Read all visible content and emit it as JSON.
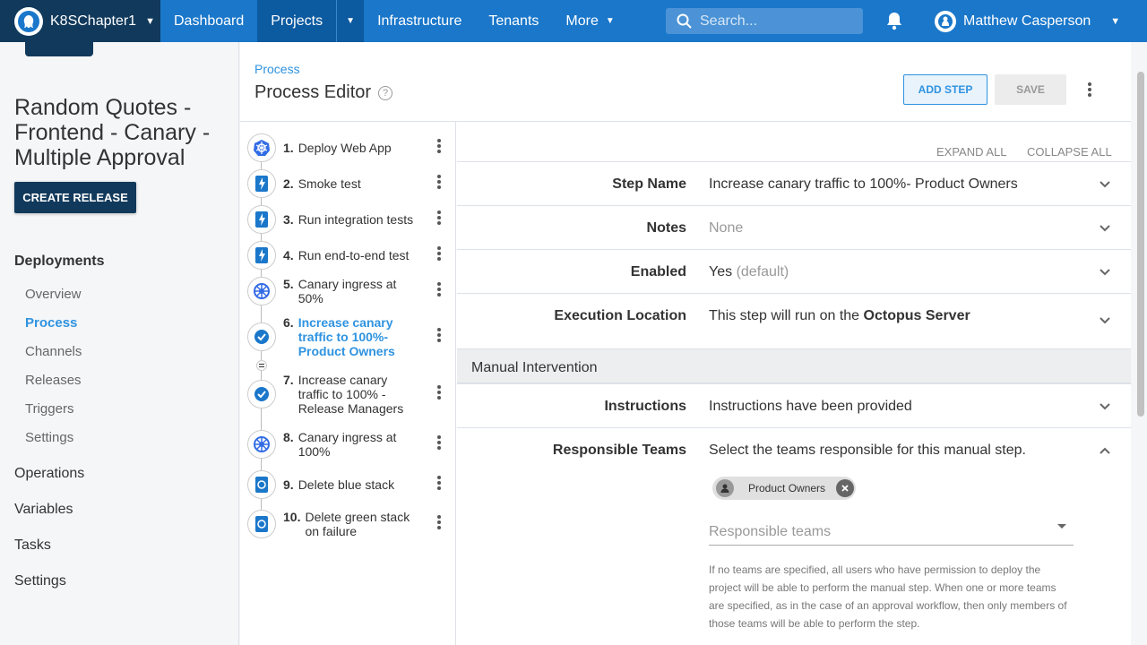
{
  "topnav": {
    "space": "K8SChapter1",
    "items": [
      "Dashboard",
      "Projects",
      "Infrastructure",
      "Tenants",
      "More"
    ],
    "search_placeholder": "Search...",
    "user": "Matthew Casperson"
  },
  "sidebar": {
    "project_title": "Random Quotes - Frontend - Canary - Multiple Approval",
    "create_release": "CREATE RELEASE",
    "deployments_heading": "Deployments",
    "deployments_items": [
      "Overview",
      "Process",
      "Channels",
      "Releases",
      "Triggers",
      "Settings"
    ],
    "active_item": "Process",
    "sections": [
      "Operations",
      "Variables",
      "Tasks",
      "Settings"
    ]
  },
  "main": {
    "breadcrumb": "Process",
    "title": "Process Editor",
    "add_step": "ADD STEP",
    "save": "SAVE",
    "expand_all": "EXPAND ALL",
    "collapse_all": "COLLAPSE ALL"
  },
  "steps": [
    {
      "num": "1.",
      "label": "Deploy Web App",
      "icon": "kubernetes-icon"
    },
    {
      "num": "2.",
      "label": "Smoke test",
      "icon": "script-icon"
    },
    {
      "num": "3.",
      "label": "Run integration tests",
      "icon": "script-icon"
    },
    {
      "num": "4.",
      "label": "Run end-to-end test",
      "icon": "script-icon"
    },
    {
      "num": "5.",
      "label": "Canary ingress at 50%",
      "icon": "kubernetes-icon"
    },
    {
      "num": "6.",
      "label": "Increase canary traffic to 100%- Product Owners",
      "icon": "check-icon",
      "selected": true
    },
    {
      "num": "7.",
      "label": "Increase canary traffic to 100% - Release Managers",
      "icon": "check-icon"
    },
    {
      "num": "8.",
      "label": "Canary ingress at 100%",
      "icon": "kubernetes-icon"
    },
    {
      "num": "9.",
      "label": "Delete blue stack",
      "icon": "kubernetes-script-icon"
    },
    {
      "num": "10.",
      "label": "Delete green stack on failure",
      "icon": "kubernetes-script-icon"
    }
  ],
  "details": {
    "step_name_label": "Step Name",
    "step_name_value": "Increase canary traffic to 100%- Product Owners",
    "notes_label": "Notes",
    "notes_value": "None",
    "enabled_label": "Enabled",
    "enabled_value": "Yes",
    "enabled_default": "(default)",
    "exec_label": "Execution Location",
    "exec_value_prefix": "This step will run on the",
    "exec_value_bold": "Octopus Server",
    "section_title": "Manual Intervention",
    "instructions_label": "Instructions",
    "instructions_value": "Instructions have been provided",
    "teams_label": "Responsible Teams",
    "teams_value": "Select the teams responsible for this manual step.",
    "team_chip": "Product Owners",
    "teams_placeholder": "Responsible teams",
    "teams_help": "If no teams are specified, all users who have permission to deploy the project will be able to perform the manual step. When one or more teams are specified, as in the case of an approval workflow, then only members of those teams will be able to perform the step."
  },
  "colors": {
    "nav_blue": "#1a77ca",
    "nav_dark": "#11395b",
    "accent": "#2f93e0"
  }
}
